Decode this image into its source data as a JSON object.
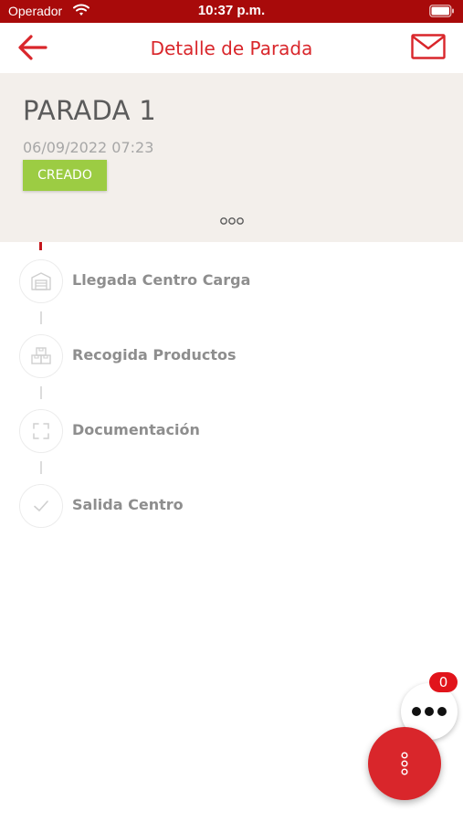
{
  "status_bar": {
    "carrier": "Operador",
    "time": "10:37 p.m."
  },
  "nav": {
    "title": "Detalle de Parada",
    "back_icon": "arrow-left-icon",
    "mail_icon": "envelope-icon"
  },
  "stop": {
    "title": "PARADA 1",
    "datetime": "06/09/2022 07:23",
    "status": "CREADO",
    "status_color": "#9ccc43"
  },
  "steps": [
    {
      "label": "Llegada Centro Carga",
      "icon": "warehouse-icon"
    },
    {
      "label": "Recogida Productos",
      "icon": "boxes-icon"
    },
    {
      "label": "Documentación",
      "icon": "scan-frame-icon"
    },
    {
      "label": "Salida Centro",
      "icon": "check-icon"
    }
  ],
  "fab": {
    "badge_count": "0",
    "secondary_icon": "more-horizontal-icon",
    "primary_icon": "more-vertical-icon"
  },
  "colors": {
    "accent": "#d9262b",
    "status_bar": "#a80a0a",
    "panel_bg": "#f3efeb"
  }
}
